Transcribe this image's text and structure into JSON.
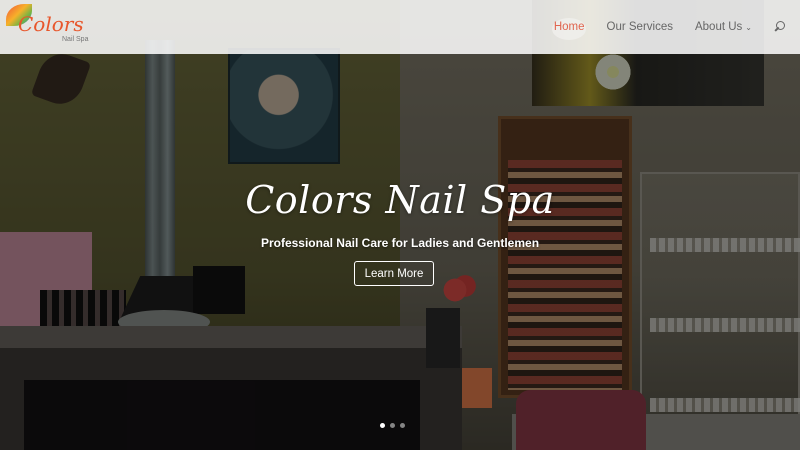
{
  "header": {
    "logo": {
      "text": "Colors",
      "subtext": "Nail Spa"
    },
    "nav": [
      {
        "label": "Home",
        "active": true
      },
      {
        "label": "Our Services",
        "active": false
      },
      {
        "label": "About Us",
        "active": false,
        "has_dropdown": true
      }
    ],
    "search_icon": "search-icon",
    "active_color": "#e0654f",
    "text_color": "#666666"
  },
  "hero": {
    "title": "Colors Nail Spa",
    "subtitle": "Professional Nail Care for Ladies and Gentlemen",
    "button_label": "Learn More",
    "slides": {
      "count": 3,
      "active_index": 0
    }
  }
}
